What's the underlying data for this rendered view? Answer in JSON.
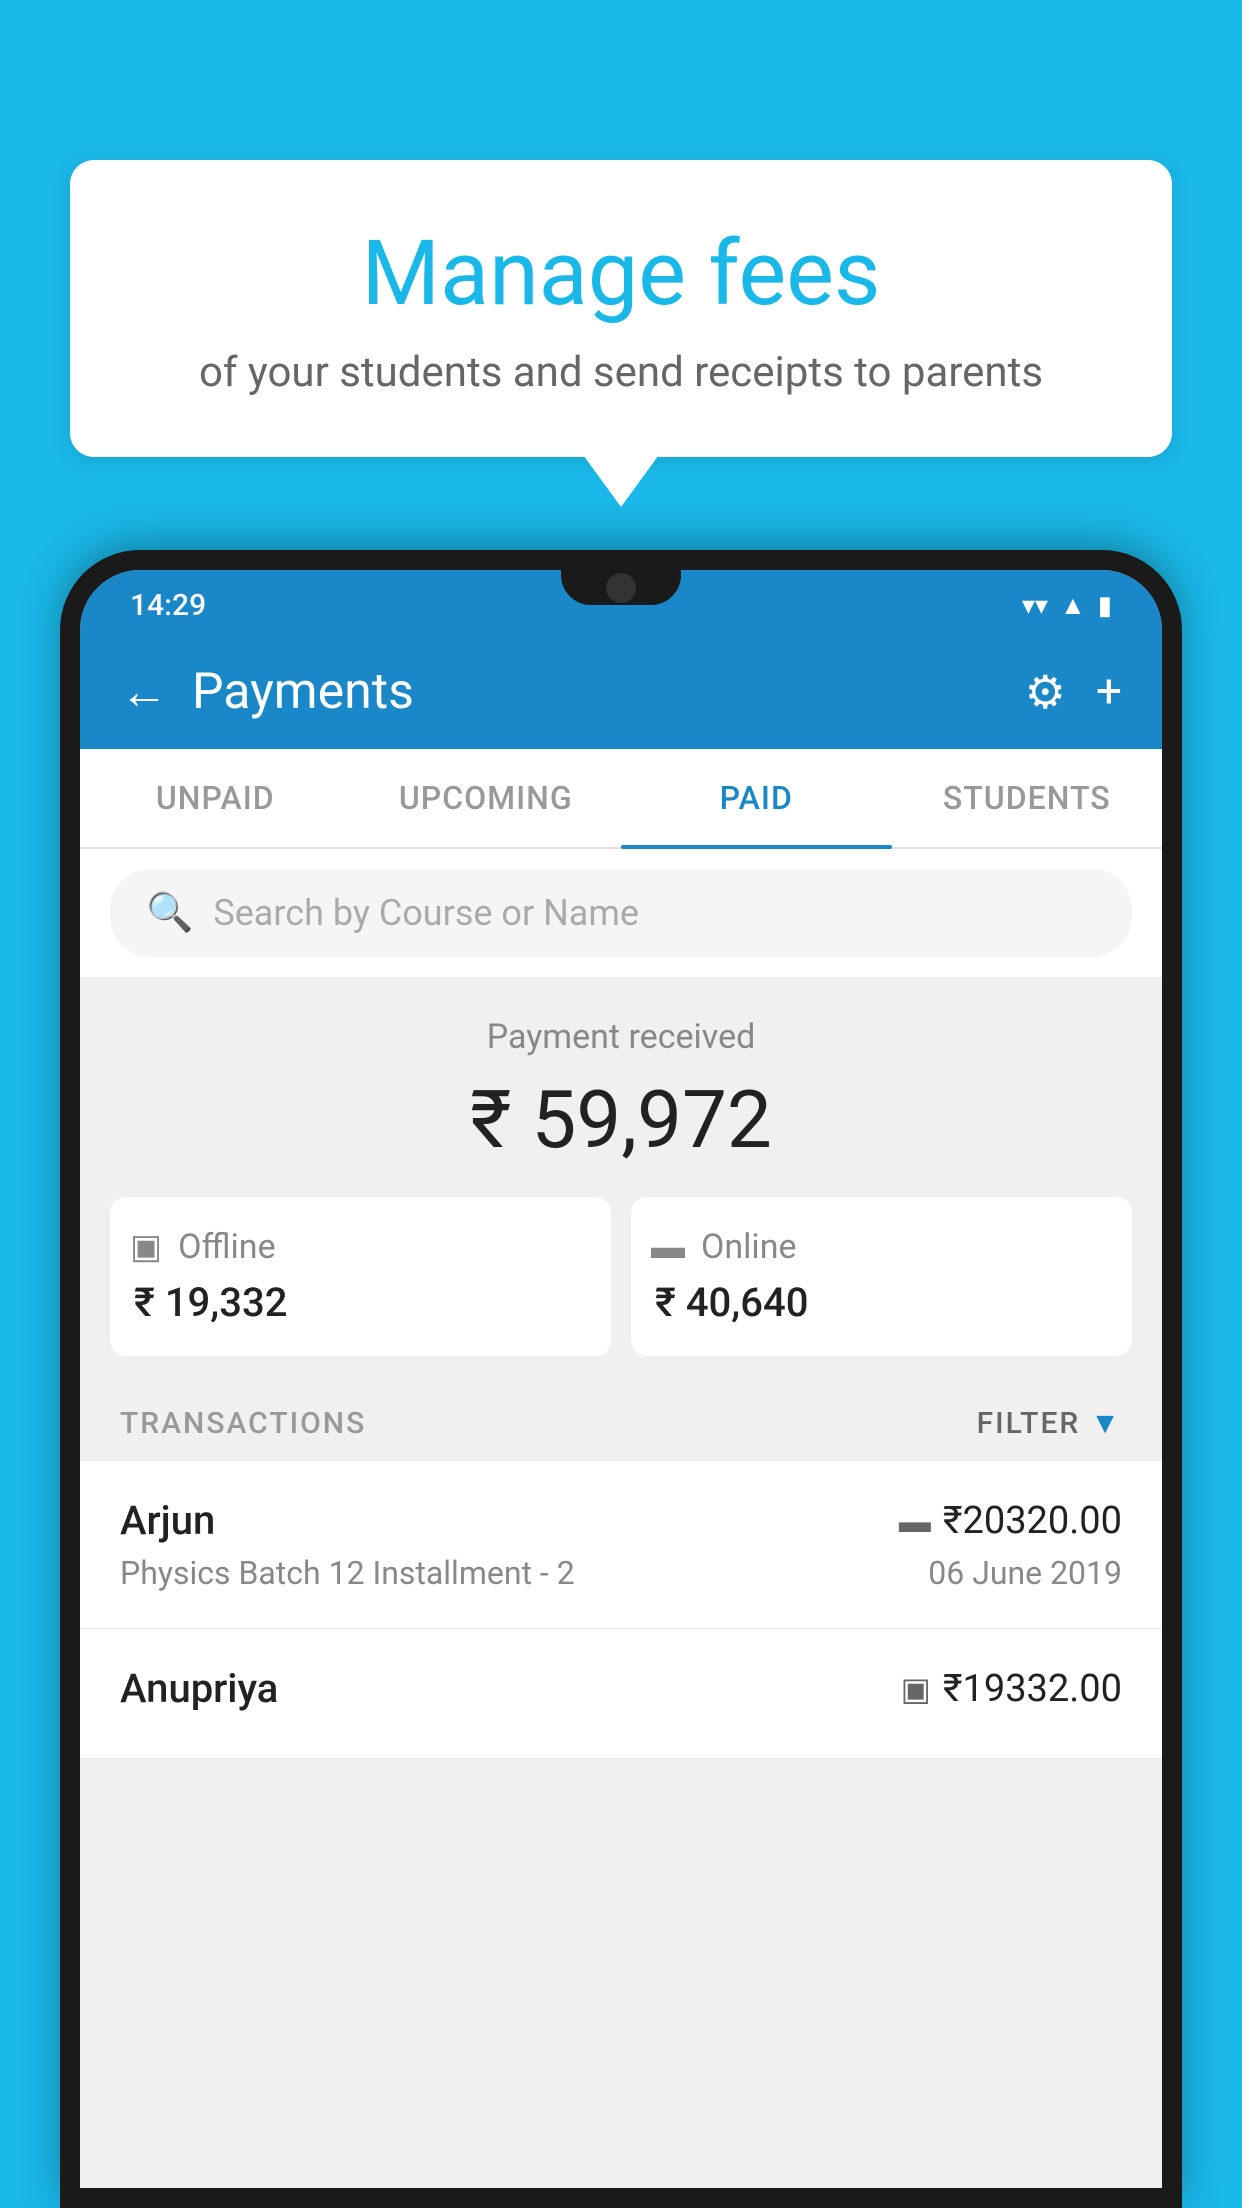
{
  "page": {
    "background_color": "#1ab8e8"
  },
  "speech_bubble": {
    "title": "Manage fees",
    "subtitle": "of your students and send receipts to parents"
  },
  "status_bar": {
    "time": "14:29",
    "wifi_icon": "▼",
    "signal_icon": "▲",
    "battery_icon": "▮"
  },
  "header": {
    "back_label": "←",
    "title": "Payments",
    "settings_icon": "⚙",
    "add_icon": "+"
  },
  "tabs": [
    {
      "label": "UNPAID",
      "active": false
    },
    {
      "label": "UPCOMING",
      "active": false
    },
    {
      "label": "PAID",
      "active": true
    },
    {
      "label": "STUDENTS",
      "active": false
    }
  ],
  "search": {
    "placeholder": "Search by Course or Name"
  },
  "payment_summary": {
    "label": "Payment received",
    "total": "₹ 59,972",
    "offline_label": "Offline",
    "offline_amount": "₹ 19,332",
    "online_label": "Online",
    "online_amount": "₹ 40,640"
  },
  "transactions_section": {
    "label": "TRANSACTIONS",
    "filter_label": "FILTER"
  },
  "transactions": [
    {
      "name": "Arjun",
      "type_icon": "▬",
      "amount": "₹20320.00",
      "course": "Physics Batch 12 Installment - 2",
      "date": "06 June 2019"
    },
    {
      "name": "Anupriya",
      "type_icon": "▣",
      "amount": "₹19332.00",
      "course": "",
      "date": ""
    }
  ]
}
